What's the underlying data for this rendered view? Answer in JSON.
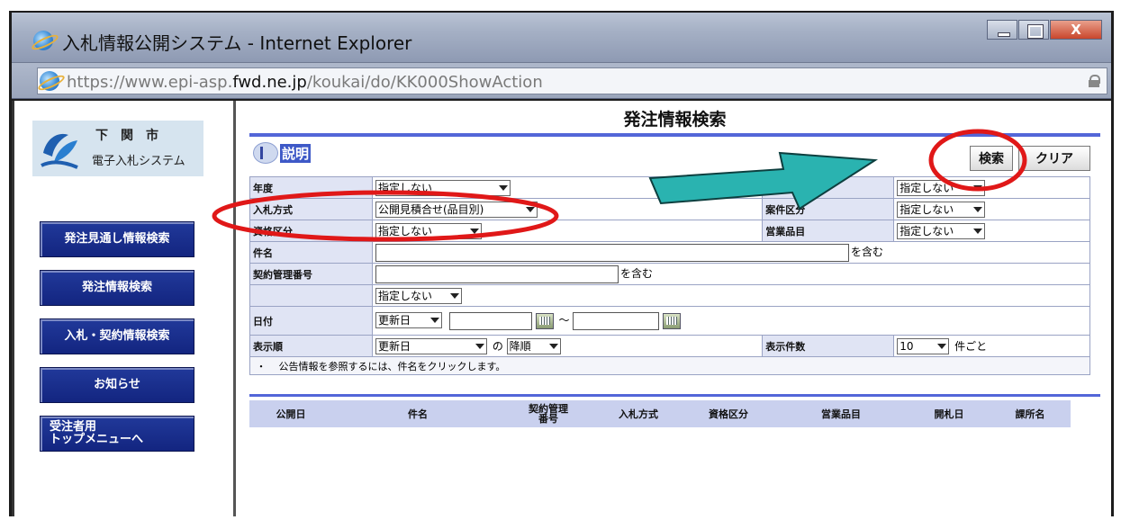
{
  "window": {
    "title": "入札情報公開システム - Internet Explorer",
    "close_glyph": "X"
  },
  "address": {
    "url_prefix": "https://www.epi-asp.",
    "url_domain": "fwd.ne.jp",
    "url_path": "/koukai/do/KK000ShowAction"
  },
  "logo": {
    "city": "下関市",
    "system": "電子入札システム"
  },
  "nav": [
    {
      "label": "発注見通し情報検索"
    },
    {
      "label": "発注情報検索"
    },
    {
      "label": "入札・契約情報検索"
    },
    {
      "label": "お知らせ"
    },
    {
      "label": "受注者用\nトップメニューへ"
    }
  ],
  "main": {
    "title": "発注情報検索",
    "help_label": "説明",
    "search_button": "検索",
    "clear_button": "クリア"
  },
  "form": {
    "year_label": "年度",
    "year_value": "指定しない",
    "year_right_value": "指定しない",
    "bid_method_label": "入札方式",
    "bid_method_value": "公開見積合せ(品目別)",
    "case_type_label": "案件区分",
    "case_type_value": "指定しない",
    "qualification_label": "資格区分",
    "qualification_value": "指定しない",
    "business_item_label": "営業品目",
    "business_item_value": "指定しない",
    "subject_label": "件名",
    "subject_suffix": "を含む",
    "contract_no_label": "契約管理番号",
    "contract_no_suffix": "を含む",
    "extra_select_value": "指定しない",
    "date_label": "日付",
    "date_type_value": "更新日",
    "date_range_sep": "～",
    "order_label": "表示順",
    "order_field_value": "更新日",
    "order_of": "の",
    "order_dir_value": "降順",
    "count_label": "表示件数",
    "count_value": "10",
    "count_suffix": "件ごと",
    "note_bullet": "・",
    "note": "公告情報を参照するには、件名をクリックします。"
  },
  "results": {
    "columns": [
      "公開日",
      "件名",
      "契約管理\n番号",
      "入札方式",
      "資格区分",
      "営業品目",
      "開札日",
      "課所名"
    ]
  },
  "colors": {
    "accent_blue": "#5366d8",
    "nav_blue": "#1a2f8f",
    "highlight_red": "#e01818",
    "arrow_teal": "#2ab3b0"
  }
}
